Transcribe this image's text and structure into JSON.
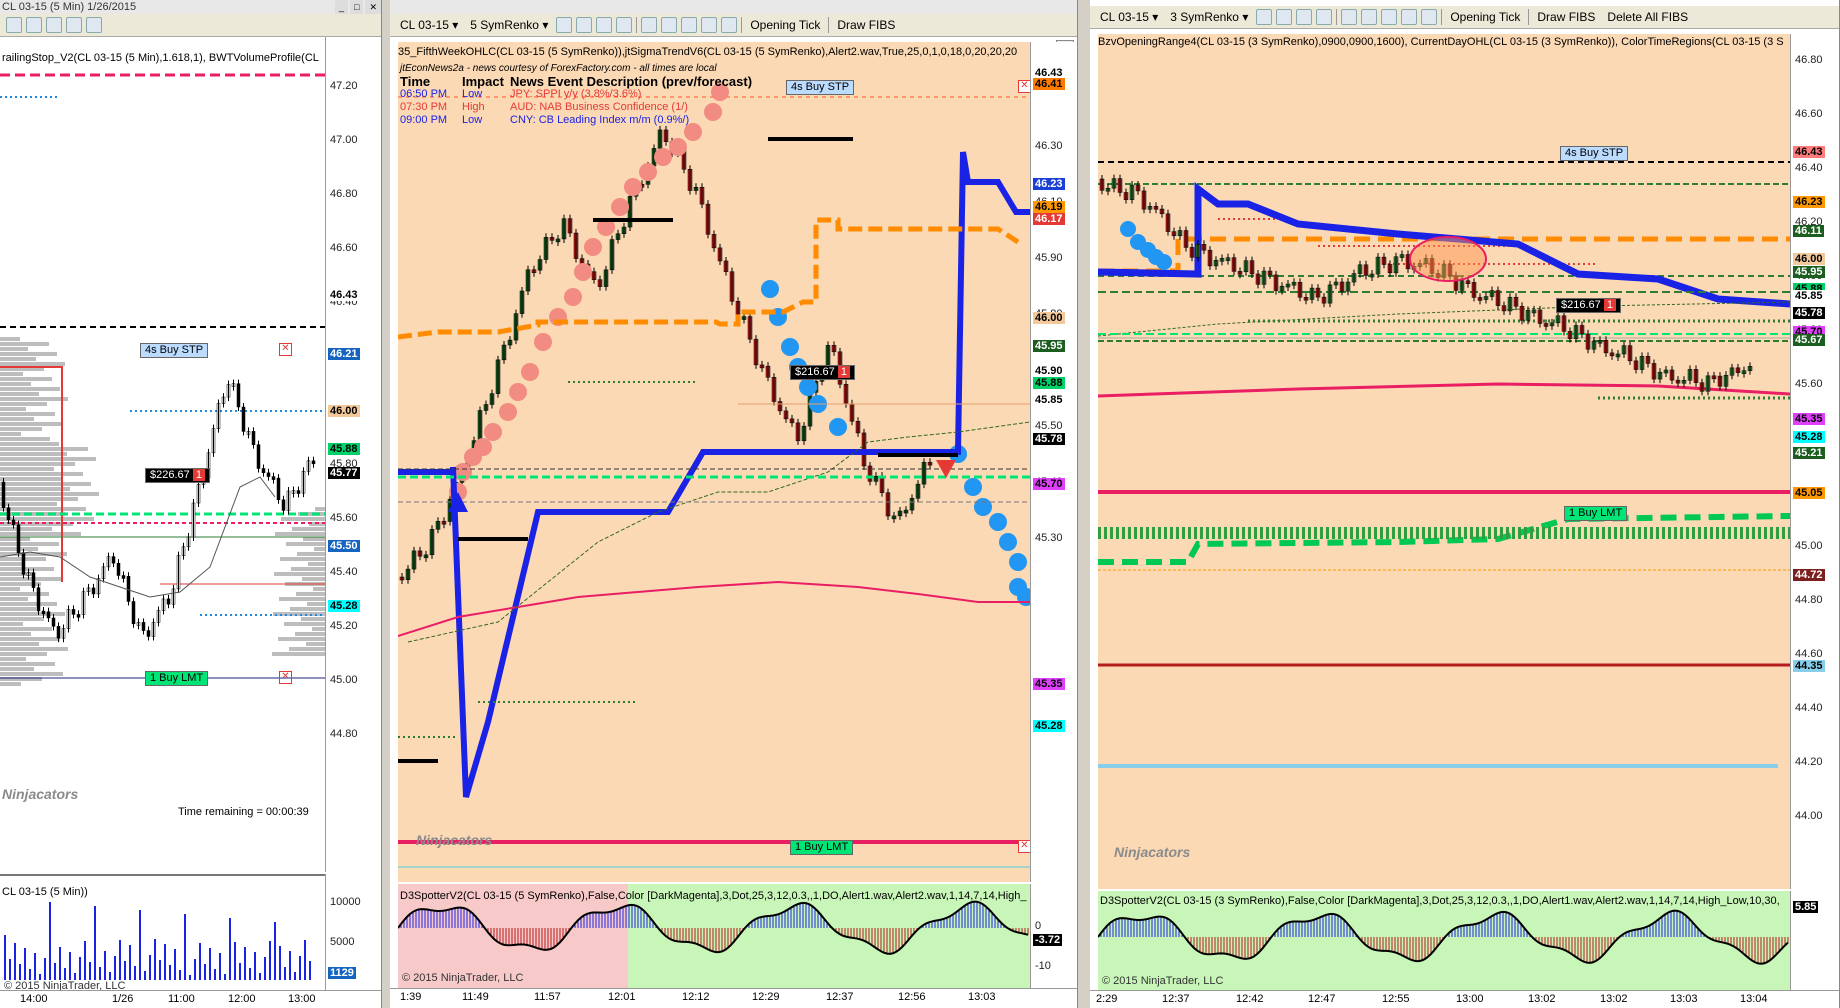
{
  "left": {
    "title": "CL 03-15 (5 Min)  1/26/2015",
    "indicator_text": "railingStop_V2(CL 03-15 (5 Min),1.618,1), BWTVolumeProfile(CL",
    "price_ticks": [
      "47.20",
      "47.00",
      "46.80",
      "46.60",
      "46.40",
      "46.20",
      "46.00",
      "45.80",
      "45.60",
      "45.40",
      "45.20",
      "45.00",
      "44.80"
    ],
    "price_tags": [
      {
        "text": "46.43",
        "bg": "#ffffff",
        "fg": "#000000"
      },
      {
        "text": "46.21",
        "bg": "#1565c0",
        "fg": "#ffffff"
      },
      {
        "text": "46.00",
        "bg": "#f3c89a",
        "fg": "#000000"
      },
      {
        "text": "45.88",
        "bg": "#00d26a",
        "fg": "#000000"
      },
      {
        "text": "45.77",
        "bg": "#000000",
        "fg": "#ffffff"
      },
      {
        "text": "45.50",
        "bg": "#1565c0",
        "fg": "#ffffff"
      },
      {
        "text": "45.28",
        "bg": "#00ffff",
        "fg": "#000000"
      }
    ],
    "buy_stp": "4s  Buy STP",
    "pnl": "$226.67",
    "pnl_qty": "1",
    "buy_lmt": "1  Buy LMT",
    "time_remaining": "Time remaining = 00:00:39",
    "logo": "Ninjacators",
    "vol_title": "CL 03-15 (5 Min))",
    "vol_ticks": [
      "10000",
      "5000",
      "0"
    ],
    "vol_tag": "1129",
    "copyright": "© 2015 NinjaTrader, LLC",
    "time_labels": [
      "14:00",
      "1/26",
      "11:00",
      "12:00",
      "13:00"
    ]
  },
  "mid": {
    "toolbar": {
      "instrument": "CL 03-15",
      "period": "5 SymRenko",
      "opening": "Opening Tick",
      "fibs": "Draw FIBS"
    },
    "indicator_text": "35_FifthWeekOHLC(CL 03-15 (5 SymRenko)),jtSigmaTrendV6(CL 03-15 (5 SymRenko),Alert2.wav,True,25,0,1,0,18,0,20,20,20",
    "news_header": "jtEconNews2a - news courtesy of ForexFactory.com - all times are local",
    "news_cols": [
      "Time",
      "Impact",
      "News Event Description (prev/forecast)"
    ],
    "news_rows": [
      {
        "time": "06:50 PM",
        "impact": "Low",
        "desc": "JPY: SPPI y/y (3.8%/3.6%)",
        "color": "#0000cc"
      },
      {
        "time": "07:30 PM",
        "impact": "High",
        "desc": "AUD: NAB Business Confidence (1/)",
        "color": "#d32f2f"
      },
      {
        "time": "09:00 PM",
        "impact": "Low",
        "desc": "CNY: CB Leading Index m/m (0.9%/)",
        "color": "#0000cc"
      }
    ],
    "price_ticks": [
      "46.30",
      "46.10",
      "45.90",
      "45.80",
      "45.60",
      "45.50",
      "45.40",
      "45.30"
    ],
    "price_tags": [
      {
        "text": "46.43",
        "bg": "#ffffff",
        "fg": "#000000"
      },
      {
        "text": "46.41",
        "bg": "#ff7b00",
        "fg": "#000000"
      },
      {
        "text": "46.23",
        "bg": "#1a3fd6",
        "fg": "#ffffff"
      },
      {
        "text": "46.19",
        "bg": "#ff9800",
        "fg": "#000000"
      },
      {
        "text": "46.17",
        "bg": "#e53935",
        "fg": "#ffffff"
      },
      {
        "text": "46.00",
        "bg": "#f3c89a",
        "fg": "#000000"
      },
      {
        "text": "45.95",
        "bg": "#1b5e20",
        "fg": "#ffffff"
      },
      {
        "text": "45.90",
        "bg": "#ffffff",
        "fg": "#000000"
      },
      {
        "text": "45.88",
        "bg": "#00d26a",
        "fg": "#000000"
      },
      {
        "text": "45.85",
        "bg": "#ffffff",
        "fg": "#000000"
      },
      {
        "text": "45.78",
        "bg": "#000000",
        "fg": "#ffffff"
      },
      {
        "text": "45.70",
        "bg": "#e040fb",
        "fg": "#000000"
      },
      {
        "text": "45.35",
        "bg": "#e040fb",
        "fg": "#000000"
      },
      {
        "text": "45.28",
        "bg": "#00ffff",
        "fg": "#000000"
      }
    ],
    "buy_stp": "4s  Buy STP",
    "pnl": "$216.67",
    "pnl_qty": "1",
    "buy_lmt": "1  Buy LMT",
    "logo": "Ninjacators",
    "osc_title": "D3SpotterV2(CL 03-15 (5 SymRenko),False,Color [DarkMagenta],3,Dot,25,3,12,0.3,,1,DO,Alert1.wav,Alert2.wav,1,14,7,14,High_",
    "osc_ticks": [
      "0",
      "-10"
    ],
    "osc_tag": "-3.72",
    "copyright": "© 2015 NinjaTrader, LLC",
    "time_labels": [
      "1:39",
      "11:49",
      "11:57",
      "12:01",
      "12:12",
      "12:29",
      "12:37",
      "12:56",
      "13:03"
    ]
  },
  "right": {
    "toolbar": {
      "instrument": "CL 03-15",
      "period": "3 SymRenko",
      "opening": "Opening Tick",
      "fibs": "Draw FIBS",
      "delete": "Delete All FIBS"
    },
    "indicator_text": "BzvOpeningRange4(CL 03-15 (3 SymRenko),0900,0900,1600), CurrentDayOHL(CL 03-15 (3 SymRenko)), ColorTimeRegions(CL 03-15 (3 S",
    "price_ticks": [
      "46.80",
      "46.60",
      "46.40",
      "46.20",
      "46.00",
      "45.80",
      "45.60",
      "45.40",
      "45.20",
      "45.00",
      "44.80",
      "44.60",
      "44.40",
      "44.20",
      "44.00"
    ],
    "price_tags": [
      {
        "text": "46.43",
        "bg": "#ff7b7b",
        "fg": "#000000"
      },
      {
        "text": "46.23",
        "bg": "#ff9800",
        "fg": "#000000"
      },
      {
        "text": "46.11",
        "bg": "#1b5e20",
        "fg": "#ffffff"
      },
      {
        "text": "46.00",
        "bg": "#f3c89a",
        "fg": "#000000"
      },
      {
        "text": "45.95",
        "bg": "#1b5e20",
        "fg": "#ffffff"
      },
      {
        "text": "45.88",
        "bg": "#00d26a",
        "fg": "#000000"
      },
      {
        "text": "45.85",
        "bg": "#ffffff",
        "fg": "#000000"
      },
      {
        "text": "45.78",
        "bg": "#000000",
        "fg": "#ffffff"
      },
      {
        "text": "45.70",
        "bg": "#e040fb",
        "fg": "#000000"
      },
      {
        "text": "45.67",
        "bg": "#1b5e20",
        "fg": "#ffffff"
      },
      {
        "text": "45.35",
        "bg": "#e040fb",
        "fg": "#000000"
      },
      {
        "text": "45.28",
        "bg": "#00ffff",
        "fg": "#000000"
      },
      {
        "text": "45.21",
        "bg": "#1b5e20",
        "fg": "#ffffff"
      },
      {
        "text": "45.05",
        "bg": "#ff9800",
        "fg": "#000000"
      },
      {
        "text": "44.72",
        "bg": "#7b1f1f",
        "fg": "#ffffff"
      },
      {
        "text": "44.35",
        "bg": "#87ceeb",
        "fg": "#000000"
      }
    ],
    "buy_stp": "4s  Buy STP",
    "pnl": "$216.67",
    "pnl_qty": "1",
    "buy_lmt": "1  Buy LMT",
    "logo": "Ninjacators",
    "osc_title": "D3SpotterV2(CL 03-15 (3 SymRenko),False,Color [DarkMagenta],3,Dot,25,3,12,0.3,,1,DO,Alert1.wav,Alert2.wav,1,14,7,14,High_Low,10,30,",
    "osc_tag": "5.85",
    "copyright": "© 2015 NinjaTrader, LLC",
    "time_labels": [
      "2:29",
      "12:37",
      "12:42",
      "12:47",
      "12:55",
      "13:00",
      "13:02",
      "13:02",
      "13:03",
      "13:04"
    ]
  }
}
